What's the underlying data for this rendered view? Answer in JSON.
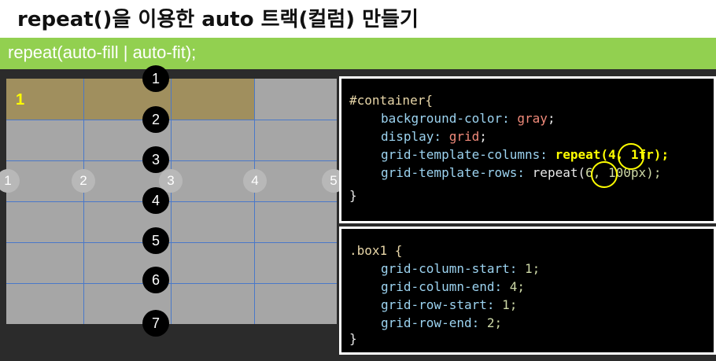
{
  "title": "repeat()을 이용한 auto 트랙(컬럼) 만들기",
  "subtitle": "repeat(auto-fill | auto-fit);",
  "demo": {
    "box_label": "1",
    "column_lines": [
      "1",
      "2",
      "3",
      "4",
      "5"
    ],
    "row_lines": [
      "1",
      "2",
      "3",
      "4",
      "5",
      "6",
      "7"
    ]
  },
  "code1": {
    "selector": "#container{",
    "l1_prop": "background-color:",
    "l1_val": "gray",
    "l2_prop": "display:",
    "l2_val": "grid",
    "l3_prop": "grid-template-columns:",
    "l3_func": "repeat(",
    "l3_num": "4",
    "l3_rest": ", 1fr);",
    "l4_prop": "grid-template-rows:",
    "l4_func": "repeat(",
    "l4_num": "6",
    "l4_rest": ", 100px);",
    "close": "}"
  },
  "code2": {
    "selector": ".box1 {",
    "l1_prop": "grid-column-start:",
    "l1_val": "1;",
    "l2_prop": "grid-column-end:",
    "l2_val": "4;",
    "l3_prop": "grid-row-start:",
    "l3_val": "1;",
    "l4_prop": "grid-row-end:",
    "l4_val": "2;",
    "close": "}"
  },
  "colors": {
    "green_bar": "#92d050",
    "grid_bg": "#a6a6a6",
    "box1": "#a08f5e",
    "grid_line": "#4a78c8",
    "highlight": "#ffff00"
  }
}
